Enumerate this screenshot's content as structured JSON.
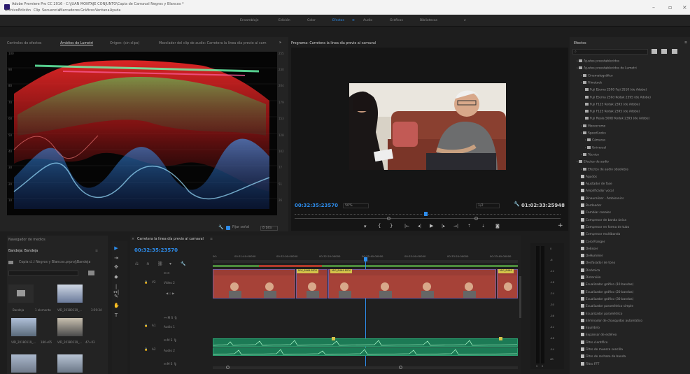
{
  "app": {
    "title": "Adobe Premiere Pro CC 2016 - C:\\JUAN MONTAJE CONJUNTO\\Copia de Carnaval Negros y Blancos *",
    "menu": [
      "Archivo",
      "Edición",
      "Clip",
      "Secuencia",
      "Marcadores",
      "Gráficos",
      "Ventana",
      "Ayuda"
    ]
  },
  "workspaces": [
    "Ensamblaje",
    "Edición",
    "Color",
    "Efectos",
    "Audio",
    "Gráficos",
    "Bibliotecas"
  ],
  "workspace_active": "Efectos",
  "workspace_more": "»",
  "source_panel": {
    "tabs": [
      "Controles de efectos",
      "Ámbitos de Lumetri",
      "Origen: (sin clips)",
      "Mezclador del clip de audio: Carretera la línea día previo al carn"
    ],
    "active_tab": "Ámbitos de Lumetri",
    "scale_left": [
      "100",
      "90",
      "80",
      "70",
      "60",
      "50",
      "40",
      "30",
      "20",
      "10"
    ],
    "scale_right": [
      "255",
      "230",
      "204",
      "179",
      "153",
      "128",
      "102",
      "77",
      "51",
      "26"
    ],
    "clamp_label": "Fijar señal",
    "bits_label": "8 bits"
  },
  "program_monitor": {
    "tab": "Programa: Carretera la línea día previo al carnaval",
    "timecode": "00:32:35:23570",
    "zoom": "50%",
    "fraction": "1/2",
    "duration": "01:02:33:25948"
  },
  "effects_panel": {
    "title": "Efectos",
    "items": [
      {
        "label": "Ajustes preestablecidos",
        "type": "folder",
        "indent": 1
      },
      {
        "label": "Ajustes preestablecidos de Lumetri",
        "type": "folder",
        "indent": 1
      },
      {
        "label": "Cinematográfico",
        "type": "folder",
        "indent": 2
      },
      {
        "label": "Filmstock",
        "type": "folder",
        "indent": 2
      },
      {
        "label": "Fuji Eterna 2500 Fuji 3510 (de Adobe)",
        "type": "preset",
        "indent": 3
      },
      {
        "label": "Fuji Eterna 250d Kodak 2395 (de Adobe)",
        "type": "preset",
        "indent": 3
      },
      {
        "label": "Fuji F125 Kodak 2393 (de Adobe)",
        "type": "preset",
        "indent": 3
      },
      {
        "label": "Fuji F125 Kodak 2395 (de Adobe)",
        "type": "preset",
        "indent": 3
      },
      {
        "label": "Fuji Reala 500D Kodak 2393 (de Adobe)",
        "type": "preset",
        "indent": 3
      },
      {
        "label": "Monocromo",
        "type": "folder",
        "indent": 2
      },
      {
        "label": "SpeedLooks",
        "type": "folder",
        "indent": 2
      },
      {
        "label": "Cámaras",
        "type": "folder",
        "indent": 3
      },
      {
        "label": "Universal",
        "type": "folder",
        "indent": 3
      },
      {
        "label": "Técnico",
        "type": "folder",
        "indent": 2
      },
      {
        "label": "Efectos de audio",
        "type": "folder",
        "indent": 1
      },
      {
        "label": "Efectos de audio obsoletos",
        "type": "folder",
        "indent": 2
      },
      {
        "label": "Agudos",
        "type": "fx",
        "indent": 2
      },
      {
        "label": "Ajustador de fase",
        "type": "fx",
        "indent": 2
      },
      {
        "label": "Amplificador vocal",
        "type": "fx",
        "indent": 2
      },
      {
        "label": "Binauralizer - Ambisonics",
        "type": "fx",
        "indent": 2
      },
      {
        "label": "Bordeador",
        "type": "fx",
        "indent": 2
      },
      {
        "label": "Cambiar canales",
        "type": "fx",
        "indent": 2
      },
      {
        "label": "Compresor de banda única",
        "type": "fx",
        "indent": 2
      },
      {
        "label": "Compresor en forma de tubo",
        "type": "fx",
        "indent": 2
      },
      {
        "label": "Compresor multibanda",
        "type": "fx",
        "indent": 2
      },
      {
        "label": "Coro/Flanger",
        "type": "fx",
        "indent": 2
      },
      {
        "label": "DeEsser",
        "type": "fx",
        "indent": 2
      },
      {
        "label": "DeHummer",
        "type": "fx",
        "indent": 2
      },
      {
        "label": "Desfasador de tono",
        "type": "fx",
        "indent": 2
      },
      {
        "label": "Dinámica",
        "type": "fx",
        "indent": 2
      },
      {
        "label": "Distorsión",
        "type": "fx",
        "indent": 2
      },
      {
        "label": "Ecualizador gráfico (10 bandas)",
        "type": "fx",
        "indent": 2
      },
      {
        "label": "Ecualizador gráfico (20 bandas)",
        "type": "fx",
        "indent": 2
      },
      {
        "label": "Ecualizador gráfico (30 bandas)",
        "type": "fx",
        "indent": 2
      },
      {
        "label": "Ecualizador paramétrico simple",
        "type": "fx",
        "indent": 2
      },
      {
        "label": "Ecualizador paramétrico",
        "type": "fx",
        "indent": 2
      },
      {
        "label": "Eliminador de chasquidos automático",
        "type": "fx",
        "indent": 2
      },
      {
        "label": "Equilibrio",
        "type": "fx",
        "indent": 2
      },
      {
        "label": "Expansor de estéreo",
        "type": "fx",
        "indent": 2
      },
      {
        "label": "Filtro científico",
        "type": "fx",
        "indent": 2
      },
      {
        "label": "Filtro de muesca sencilla",
        "type": "fx",
        "indent": 2
      },
      {
        "label": "Filtro de rechazo de banda",
        "type": "fx",
        "indent": 2
      },
      {
        "label": "Filtro FFT",
        "type": "fx",
        "indent": 2
      }
    ]
  },
  "media_panel": {
    "title": "Navegador de medios",
    "bin_title": "Bandeja: Bandeja",
    "path": "Copia d..l Negros y Blancos.prproj\\Bandeja",
    "items": [
      {
        "name": "Bandeja",
        "info": "1 elemento"
      },
      {
        "name": "VID_20180119_...",
        "info": "3:59:34"
      },
      {
        "name": "VID_20180119_...",
        "info": "180+05"
      },
      {
        "name": "VID_20180119_...",
        "info": "47+03"
      }
    ]
  },
  "timeline": {
    "tab": "Carretera la línea día previo al carnaval",
    "timecode": "00:32:35:23570",
    "ruler": [
      "00:",
      "00:31:40:00000",
      "00:32:00:00000",
      "00:32:20:00000",
      "00:32:40:00000",
      "00:33:00:00000",
      "00:33:20:00000",
      "00:33:40:00000"
    ],
    "tracks": [
      {
        "id": "V2",
        "name": "Vídeo 2"
      },
      {
        "id": "A1",
        "name": "Audio 1"
      },
      {
        "id": "A2",
        "name": "Audio 2"
      }
    ],
    "clip_labels": [
      "MVI_8464.MOV",
      "MVI_8464.MOV",
      "MVI_8464"
    ],
    "meter_scale": [
      "0",
      "-6",
      "-12",
      "-18",
      "-24",
      "-30",
      "-36",
      "-42",
      "-48",
      "-54",
      "dB"
    ],
    "meter_footer": [
      "S",
      "S"
    ]
  },
  "colors": {
    "accent": "#2d8ceb",
    "clip_video": "#9a3d35",
    "clip_audio": "#1c7a55",
    "clip_label": "#d4c44a"
  }
}
